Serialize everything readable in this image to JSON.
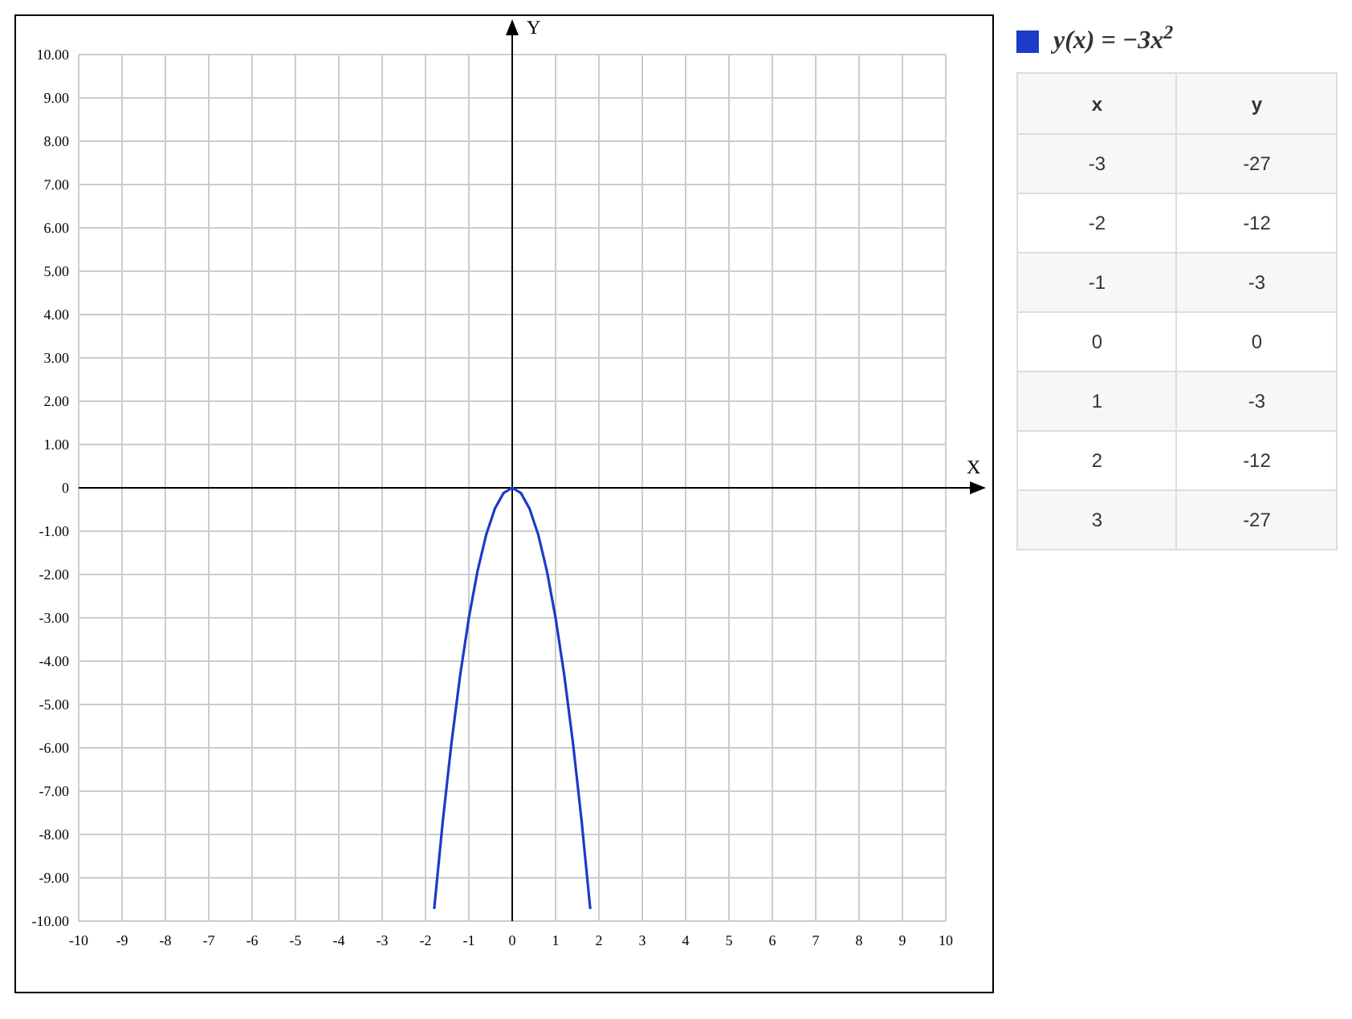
{
  "chart": {
    "chart_data": {
      "type": "line",
      "xlabel": "X",
      "ylabel": "Y",
      "x": [
        -1.8,
        -1.6,
        -1.4,
        -1.2,
        -1,
        -0.8,
        -0.6,
        -0.4,
        -0.2,
        0,
        0.2,
        0.4,
        0.6,
        0.8,
        1,
        1.2,
        1.4,
        1.6,
        1.8
      ],
      "series": [
        {
          "name": "y(x) = −3x$^{2}$",
          "color": "#1b3bc8",
          "values": [
            -9.72,
            -7.68,
            -5.88,
            -4.32,
            -3,
            -1.92,
            -1.08,
            -0.48,
            -0.12,
            0,
            -0.12,
            -0.48,
            -1.08,
            -1.92,
            -3,
            -4.32,
            -5.88,
            -7.68,
            -9.72
          ]
        }
      ],
      "xlim": [
        -10,
        10
      ],
      "ylim": [
        -10,
        10
      ],
      "grid": true,
      "xticks": [
        {
          "value": -10,
          "label": "-10"
        },
        {
          "value": -9,
          "label": "-9"
        },
        {
          "value": -8,
          "label": "-8"
        },
        {
          "value": -7,
          "label": "-7"
        },
        {
          "value": -6,
          "label": "-6"
        },
        {
          "value": -5,
          "label": "-5"
        },
        {
          "value": -4,
          "label": "-4"
        },
        {
          "value": -3,
          "label": "-3"
        },
        {
          "value": -2,
          "label": "-2"
        },
        {
          "value": -1,
          "label": "-1"
        },
        {
          "value": 0,
          "label": "0"
        },
        {
          "value": 1,
          "label": "1"
        },
        {
          "value": 2,
          "label": "2"
        },
        {
          "value": 3,
          "label": "3"
        },
        {
          "value": 4,
          "label": "4"
        },
        {
          "value": 5,
          "label": "5"
        },
        {
          "value": 6,
          "label": "6"
        },
        {
          "value": 7,
          "label": "7"
        },
        {
          "value": 8,
          "label": "8"
        },
        {
          "value": 9,
          "label": "9"
        },
        {
          "value": 10,
          "label": "10"
        }
      ],
      "yticks": [
        {
          "value": 10,
          "label": "10.00"
        },
        {
          "value": 9,
          "label": "9.00"
        },
        {
          "value": 8,
          "label": "8.00"
        },
        {
          "value": 7,
          "label": "7.00"
        },
        {
          "value": 6,
          "label": "6.00"
        },
        {
          "value": 5,
          "label": "5.00"
        },
        {
          "value": 4,
          "label": "4.00"
        },
        {
          "value": 3,
          "label": "3.00"
        },
        {
          "value": 2,
          "label": "2.00"
        },
        {
          "value": 1,
          "label": "1.00"
        },
        {
          "value": 0,
          "label": "0"
        },
        {
          "value": -1,
          "label": "-1.00"
        },
        {
          "value": -2,
          "label": "-2.00"
        },
        {
          "value": -3,
          "label": "-3.00"
        },
        {
          "value": -4,
          "label": "-4.00"
        },
        {
          "value": -5,
          "label": "-5.00"
        },
        {
          "value": -6,
          "label": "-6.00"
        },
        {
          "value": -7,
          "label": "-7.00"
        },
        {
          "value": -8,
          "label": "-8.00"
        },
        {
          "value": -9,
          "label": "-9.00"
        },
        {
          "value": -10,
          "label": "-10.00"
        }
      ]
    }
  },
  "legend": {
    "color": "#1b3bc8"
  },
  "table": {
    "columns": [
      "x",
      "y"
    ],
    "rows": [
      [
        "-3",
        "-27"
      ],
      [
        "-2",
        "-12"
      ],
      [
        "-1",
        "-3"
      ],
      [
        "0",
        "0"
      ],
      [
        "1",
        "-3"
      ],
      [
        "2",
        "-12"
      ],
      [
        "3",
        "-27"
      ]
    ]
  }
}
